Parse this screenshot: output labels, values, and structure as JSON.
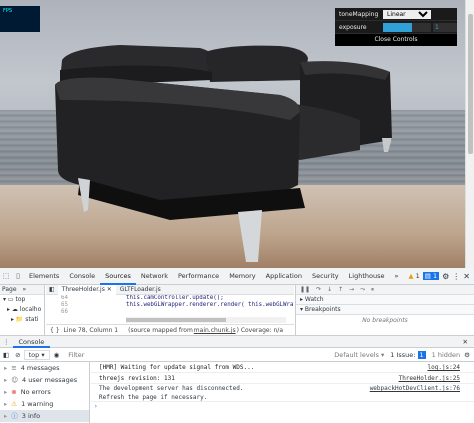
{
  "viewport": {
    "stats_label": "FPS",
    "gui": {
      "tonemapping_label": "toneMapping",
      "tonemapping_value": "Linear",
      "exposure_label": "exposure",
      "exposure_value": "1",
      "exposure_fraction": 0.6,
      "close_label": "Close Controls"
    }
  },
  "devtools": {
    "tabs": [
      "Elements",
      "Console",
      "Sources",
      "Network",
      "Performance",
      "Memory",
      "Application",
      "Security",
      "Lighthouse"
    ],
    "active_tab": "Sources",
    "more_tabs": "»",
    "warnings_badge": "1",
    "issues_badge": "1",
    "sources": {
      "nav_tab": "Page",
      "tree": [
        "top",
        "localho",
        "stati"
      ],
      "files": [
        "ThreeHolder.js",
        "GLTFLoader.js"
      ],
      "code_lines": [
        {
          "num": "64",
          "code": "this.camController.update();"
        },
        {
          "num": "65",
          "code": "this.webGLWrapper.renderer.render( this.webGLWra"
        },
        {
          "num": "66",
          "code": ""
        }
      ],
      "status_position": "Line 78, Column 1",
      "status_mapped_prefix": "(source mapped from",
      "status_mapped_file": "main.chunk.js",
      "status_mapped_suffix": ") Coverage: n/a",
      "debug_watch": "Watch",
      "debug_breakpoints": "Breakpoints",
      "debug_no_breakpoints": "No breakpoints"
    },
    "drawer_tab": "Console",
    "console": {
      "context": "top",
      "filter_placeholder": "Filter",
      "levels": "Default levels",
      "issue": "1 Issue:",
      "issue_count": "1",
      "hidden": "1 hidden",
      "sidebar": [
        {
          "icon": "list-icon",
          "label": "4 messages"
        },
        {
          "icon": "user-icon",
          "label": "4 user messages"
        },
        {
          "icon": "error-icon",
          "label": "No errors"
        },
        {
          "icon": "warning-icon",
          "label": "1 warning"
        },
        {
          "icon": "info-icon",
          "label": "3 info"
        }
      ],
      "messages": [
        {
          "text": "[HMR] Waiting for update signal from WDS...",
          "source": "log.js:24"
        },
        {
          "text": "threejs revision:  131",
          "source": "ThreeHolder.js:25"
        }
      ],
      "message_multi": {
        "line1": "The development server has disconnected.",
        "line2": "Refresh the page if necessary.",
        "source": "webpackHotDevClient.js:76"
      },
      "prompt": "›"
    }
  }
}
